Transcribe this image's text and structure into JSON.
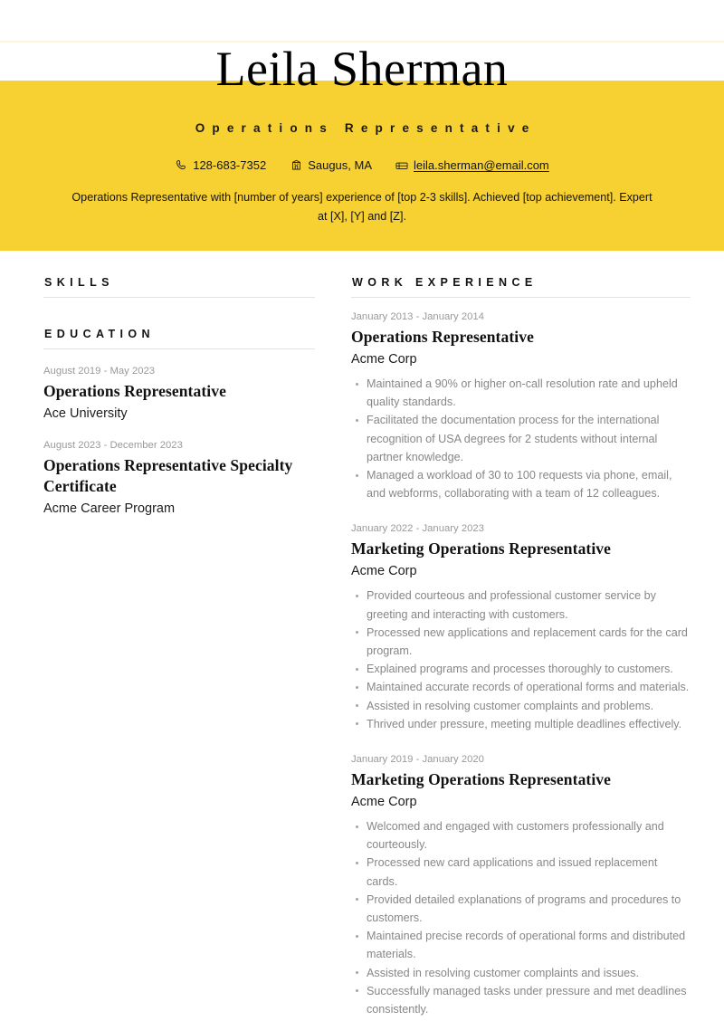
{
  "theme": {
    "accent_yellow": "#f7d032",
    "hairline": "#fdf6dd",
    "rule": "#e2e2e2",
    "body_text": "#878787",
    "date_text": "#9a9a9a"
  },
  "header": {
    "name": "Leila Sherman",
    "job_title": "Operations Representative",
    "contact": {
      "phone": "128-683-7352",
      "location": "Saugus, MA",
      "email": "leila.sherman@email.com"
    },
    "summary": "Operations Representative with [number of years] experience of [top 2-3 skills]. Achieved [top achievement]. Expert at [X], [Y] and [Z]."
  },
  "sections": {
    "skills": {
      "title": "SKILLS",
      "items": []
    },
    "education": {
      "title": "EDUCATION",
      "entries": [
        {
          "date": "August 2019 - May 2023",
          "title": "Operations Representative",
          "org": "Ace University"
        },
        {
          "date": "August 2023 - December 2023",
          "title": "Operations Representative Specialty Certificate",
          "org": "Acme Career Program"
        }
      ]
    },
    "work_experience": {
      "title": "WORK EXPERIENCE",
      "entries": [
        {
          "date": "January 2013 - January 2014",
          "title": "Operations Representative",
          "org": "Acme Corp",
          "bullets": [
            "Maintained a 90% or higher on-call resolution rate and upheld quality standards.",
            "Facilitated the documentation process for the international recognition of USA degrees for 2 students without internal partner knowledge.",
            "Managed a workload of 30 to 100 requests via phone, email, and webforms, collaborating with a team of 12 colleagues."
          ]
        },
        {
          "date": "January 2022 - January 2023",
          "title": "Marketing Operations Representative",
          "org": "Acme Corp",
          "bullets": [
            "Provided courteous and professional customer service by greeting and interacting with customers.",
            "Processed new applications and replacement cards for the card program.",
            "Explained programs and processes thoroughly to customers.",
            "Maintained accurate records of operational forms and materials.",
            "Assisted in resolving customer complaints and problems.",
            "Thrived under pressure, meeting multiple deadlines effectively."
          ]
        },
        {
          "date": "January 2019 - January 2020",
          "title": "Marketing Operations Representative",
          "org": "Acme Corp",
          "bullets": [
            "Welcomed and engaged with customers professionally and courteously.",
            "Processed new card applications and issued replacement cards.",
            "Provided detailed explanations of programs and procedures to customers.",
            "Maintained precise records of operational forms and distributed materials.",
            "Assisted in resolving customer complaints and issues.",
            "Successfully managed tasks under pressure and met deadlines consistently."
          ]
        }
      ]
    }
  }
}
